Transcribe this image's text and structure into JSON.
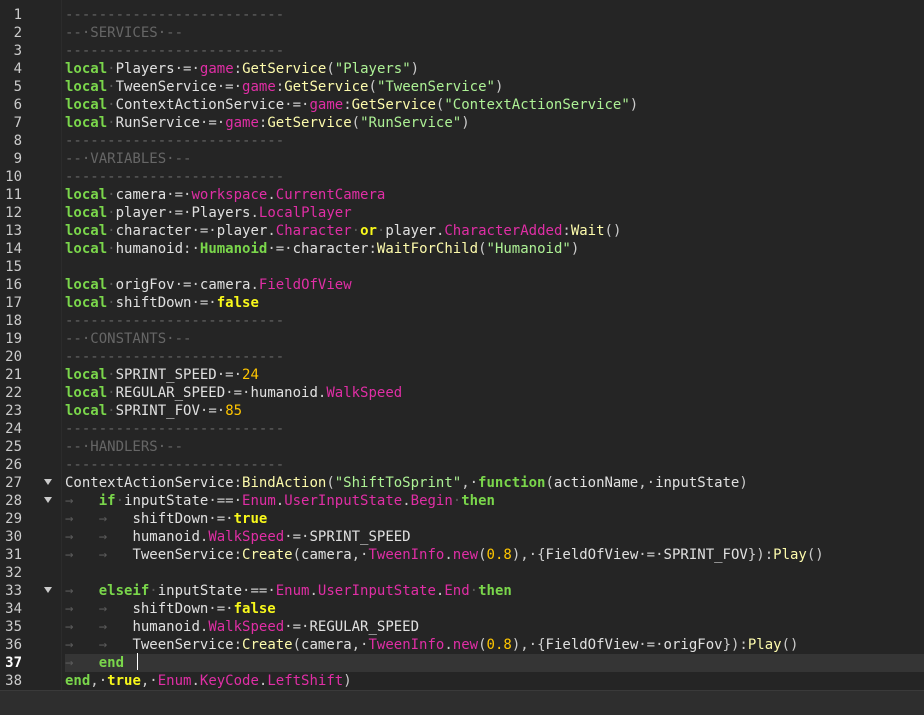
{
  "editor": {
    "current_line": 37,
    "lines": [
      {
        "n": "1",
        "tokens": [
          {
            "t": "--------------------------",
            "c": "cm"
          }
        ]
      },
      {
        "n": "2",
        "tokens": [
          {
            "t": "--·SERVICES·--",
            "c": "cm"
          }
        ]
      },
      {
        "n": "3",
        "tokens": [
          {
            "t": "--------------------------",
            "c": "cm"
          }
        ]
      },
      {
        "n": "4",
        "tokens": [
          {
            "t": "local",
            "c": "kw2"
          },
          {
            "t": "·",
            "c": "ws"
          },
          {
            "t": "Players",
            "c": "id"
          },
          {
            "t": "·=·",
            "c": "op"
          },
          {
            "t": "game",
            "c": "blt"
          },
          {
            "t": ":",
            "c": "op"
          },
          {
            "t": "GetService",
            "c": "met"
          },
          {
            "t": "(",
            "c": "op"
          },
          {
            "t": "\"Players\"",
            "c": "str"
          },
          {
            "t": ")",
            "c": "op"
          }
        ]
      },
      {
        "n": "5",
        "tokens": [
          {
            "t": "local",
            "c": "kw2"
          },
          {
            "t": "·",
            "c": "ws"
          },
          {
            "t": "TweenService",
            "c": "id"
          },
          {
            "t": "·=·",
            "c": "op"
          },
          {
            "t": "game",
            "c": "blt"
          },
          {
            "t": ":",
            "c": "op"
          },
          {
            "t": "GetService",
            "c": "met"
          },
          {
            "t": "(",
            "c": "op"
          },
          {
            "t": "\"TweenService\"",
            "c": "str"
          },
          {
            "t": ")",
            "c": "op"
          }
        ]
      },
      {
        "n": "6",
        "tokens": [
          {
            "t": "local",
            "c": "kw2"
          },
          {
            "t": "·",
            "c": "ws"
          },
          {
            "t": "ContextActionService",
            "c": "id"
          },
          {
            "t": "·=·",
            "c": "op"
          },
          {
            "t": "game",
            "c": "blt"
          },
          {
            "t": ":",
            "c": "op"
          },
          {
            "t": "GetService",
            "c": "met"
          },
          {
            "t": "(",
            "c": "op"
          },
          {
            "t": "\"ContextActionService\"",
            "c": "str"
          },
          {
            "t": ")",
            "c": "op"
          }
        ]
      },
      {
        "n": "7",
        "tokens": [
          {
            "t": "local",
            "c": "kw2"
          },
          {
            "t": "·",
            "c": "ws"
          },
          {
            "t": "RunService",
            "c": "id"
          },
          {
            "t": "·=·",
            "c": "op"
          },
          {
            "t": "game",
            "c": "blt"
          },
          {
            "t": ":",
            "c": "op"
          },
          {
            "t": "GetService",
            "c": "met"
          },
          {
            "t": "(",
            "c": "op"
          },
          {
            "t": "\"RunService\"",
            "c": "str"
          },
          {
            "t": ")",
            "c": "op"
          }
        ]
      },
      {
        "n": "8",
        "tokens": [
          {
            "t": "--------------------------",
            "c": "cm"
          }
        ]
      },
      {
        "n": "9",
        "tokens": [
          {
            "t": "--·VARIABLES·--",
            "c": "cm"
          }
        ]
      },
      {
        "n": "10",
        "tokens": [
          {
            "t": "--------------------------",
            "c": "cm"
          }
        ]
      },
      {
        "n": "11",
        "tokens": [
          {
            "t": "local",
            "c": "kw2"
          },
          {
            "t": "·",
            "c": "ws"
          },
          {
            "t": "camera",
            "c": "id"
          },
          {
            "t": "·=·",
            "c": "op"
          },
          {
            "t": "workspace",
            "c": "blt"
          },
          {
            "t": ".",
            "c": "op"
          },
          {
            "t": "CurrentCamera",
            "c": "blt"
          }
        ]
      },
      {
        "n": "12",
        "tokens": [
          {
            "t": "local",
            "c": "kw2"
          },
          {
            "t": "·",
            "c": "ws"
          },
          {
            "t": "player",
            "c": "id"
          },
          {
            "t": "·=·",
            "c": "op"
          },
          {
            "t": "Players",
            "c": "id"
          },
          {
            "t": ".",
            "c": "op"
          },
          {
            "t": "LocalPlayer",
            "c": "blt"
          }
        ]
      },
      {
        "n": "13",
        "tokens": [
          {
            "t": "local",
            "c": "kw2"
          },
          {
            "t": "·",
            "c": "ws"
          },
          {
            "t": "character",
            "c": "id"
          },
          {
            "t": "·=·",
            "c": "op"
          },
          {
            "t": "player",
            "c": "id"
          },
          {
            "t": ".",
            "c": "op"
          },
          {
            "t": "Character",
            "c": "blt"
          },
          {
            "t": "·",
            "c": "ws"
          },
          {
            "t": "or",
            "c": "kw"
          },
          {
            "t": "·",
            "c": "ws"
          },
          {
            "t": "player",
            "c": "id"
          },
          {
            "t": ".",
            "c": "op"
          },
          {
            "t": "CharacterAdded",
            "c": "blt"
          },
          {
            "t": ":",
            "c": "op"
          },
          {
            "t": "Wait",
            "c": "met"
          },
          {
            "t": "()",
            "c": "op"
          }
        ]
      },
      {
        "n": "14",
        "tokens": [
          {
            "t": "local",
            "c": "kw2"
          },
          {
            "t": "·",
            "c": "ws"
          },
          {
            "t": "humanoid",
            "c": "id"
          },
          {
            "t": ":·",
            "c": "op"
          },
          {
            "t": "Humanoid",
            "c": "kw2"
          },
          {
            "t": "·=·",
            "c": "op"
          },
          {
            "t": "character",
            "c": "id"
          },
          {
            "t": ":",
            "c": "op"
          },
          {
            "t": "WaitForChild",
            "c": "met"
          },
          {
            "t": "(",
            "c": "op"
          },
          {
            "t": "\"Humanoid\"",
            "c": "str"
          },
          {
            "t": ")",
            "c": "op"
          }
        ]
      },
      {
        "n": "15",
        "tokens": []
      },
      {
        "n": "16",
        "tokens": [
          {
            "t": "local",
            "c": "kw2"
          },
          {
            "t": "·",
            "c": "ws"
          },
          {
            "t": "origFov",
            "c": "id"
          },
          {
            "t": "·=·",
            "c": "op"
          },
          {
            "t": "camera",
            "c": "id"
          },
          {
            "t": ".",
            "c": "op"
          },
          {
            "t": "FieldOfView",
            "c": "blt"
          }
        ]
      },
      {
        "n": "17",
        "tokens": [
          {
            "t": "local",
            "c": "kw2"
          },
          {
            "t": "·",
            "c": "ws"
          },
          {
            "t": "shiftDown",
            "c": "id"
          },
          {
            "t": "·=·",
            "c": "op"
          },
          {
            "t": "false",
            "c": "kw"
          }
        ]
      },
      {
        "n": "18",
        "tokens": [
          {
            "t": "--------------------------",
            "c": "cm"
          }
        ]
      },
      {
        "n": "19",
        "tokens": [
          {
            "t": "--·CONSTANTS·--",
            "c": "cm"
          }
        ]
      },
      {
        "n": "20",
        "tokens": [
          {
            "t": "--------------------------",
            "c": "cm"
          }
        ]
      },
      {
        "n": "21",
        "tokens": [
          {
            "t": "local",
            "c": "kw2"
          },
          {
            "t": "·",
            "c": "ws"
          },
          {
            "t": "SPRINT_SPEED",
            "c": "id"
          },
          {
            "t": "·=·",
            "c": "op"
          },
          {
            "t": "24",
            "c": "num"
          }
        ]
      },
      {
        "n": "22",
        "tokens": [
          {
            "t": "local",
            "c": "kw2"
          },
          {
            "t": "·",
            "c": "ws"
          },
          {
            "t": "REGULAR_SPEED",
            "c": "id"
          },
          {
            "t": "·=·",
            "c": "op"
          },
          {
            "t": "humanoid",
            "c": "id"
          },
          {
            "t": ".",
            "c": "op"
          },
          {
            "t": "WalkSpeed",
            "c": "blt"
          }
        ]
      },
      {
        "n": "23",
        "tokens": [
          {
            "t": "local",
            "c": "kw2"
          },
          {
            "t": "·",
            "c": "ws"
          },
          {
            "t": "SPRINT_FOV",
            "c": "id"
          },
          {
            "t": "·=·",
            "c": "op"
          },
          {
            "t": "85",
            "c": "num"
          }
        ]
      },
      {
        "n": "24",
        "tokens": [
          {
            "t": "--------------------------",
            "c": "cm"
          }
        ]
      },
      {
        "n": "25",
        "tokens": [
          {
            "t": "--·HANDLERS·--",
            "c": "cm"
          }
        ]
      },
      {
        "n": "26",
        "tokens": [
          {
            "t": "--------------------------",
            "c": "cm"
          }
        ]
      },
      {
        "n": "27",
        "fold": true,
        "tokens": [
          {
            "t": "ContextActionService",
            "c": "id"
          },
          {
            "t": ":",
            "c": "op"
          },
          {
            "t": "BindAction",
            "c": "met"
          },
          {
            "t": "(",
            "c": "op"
          },
          {
            "t": "\"ShiftToSprint\"",
            "c": "str"
          },
          {
            "t": ",·",
            "c": "op"
          },
          {
            "t": "function",
            "c": "kw2"
          },
          {
            "t": "(",
            "c": "op"
          },
          {
            "t": "actionName",
            "c": "id"
          },
          {
            "t": ",·",
            "c": "op"
          },
          {
            "t": "inputState",
            "c": "id"
          },
          {
            "t": ")",
            "c": "op"
          }
        ]
      },
      {
        "n": "28",
        "fold": true,
        "tokens": [
          {
            "t": "→   ",
            "c": "tabarrow"
          },
          {
            "t": "if",
            "c": "kw2"
          },
          {
            "t": "·",
            "c": "ws"
          },
          {
            "t": "inputState",
            "c": "id"
          },
          {
            "t": "·==·",
            "c": "op"
          },
          {
            "t": "Enum",
            "c": "blt"
          },
          {
            "t": ".",
            "c": "op"
          },
          {
            "t": "UserInputState",
            "c": "blt"
          },
          {
            "t": ".",
            "c": "op"
          },
          {
            "t": "Begin",
            "c": "blt"
          },
          {
            "t": "·",
            "c": "ws"
          },
          {
            "t": "then",
            "c": "kw2"
          }
        ]
      },
      {
        "n": "29",
        "tokens": [
          {
            "t": "→   →   ",
            "c": "tabarrow"
          },
          {
            "t": "shiftDown",
            "c": "id"
          },
          {
            "t": "·=·",
            "c": "op"
          },
          {
            "t": "true",
            "c": "kw"
          }
        ]
      },
      {
        "n": "30",
        "tokens": [
          {
            "t": "→   →   ",
            "c": "tabarrow"
          },
          {
            "t": "humanoid",
            "c": "id"
          },
          {
            "t": ".",
            "c": "op"
          },
          {
            "t": "WalkSpeed",
            "c": "blt"
          },
          {
            "t": "·=·",
            "c": "op"
          },
          {
            "t": "SPRINT_SPEED",
            "c": "id"
          }
        ]
      },
      {
        "n": "31",
        "tokens": [
          {
            "t": "→   →   ",
            "c": "tabarrow"
          },
          {
            "t": "TweenService",
            "c": "id"
          },
          {
            "t": ":",
            "c": "op"
          },
          {
            "t": "Create",
            "c": "met"
          },
          {
            "t": "(",
            "c": "op"
          },
          {
            "t": "camera",
            "c": "id"
          },
          {
            "t": ",·",
            "c": "op"
          },
          {
            "t": "TweenInfo",
            "c": "blt"
          },
          {
            "t": ".",
            "c": "op"
          },
          {
            "t": "new",
            "c": "blt"
          },
          {
            "t": "(",
            "c": "op"
          },
          {
            "t": "0.8",
            "c": "num"
          },
          {
            "t": "),·{",
            "c": "op"
          },
          {
            "t": "FieldOfView",
            "c": "id"
          },
          {
            "t": "·=·",
            "c": "op"
          },
          {
            "t": "SPRINT_FOV",
            "c": "id"
          },
          {
            "t": "}):",
            "c": "op"
          },
          {
            "t": "Play",
            "c": "met"
          },
          {
            "t": "()",
            "c": "op"
          }
        ]
      },
      {
        "n": "32",
        "tokens": []
      },
      {
        "n": "33",
        "fold": true,
        "tokens": [
          {
            "t": "→   ",
            "c": "tabarrow"
          },
          {
            "t": "elseif",
            "c": "kw2"
          },
          {
            "t": "·",
            "c": "ws"
          },
          {
            "t": "inputState",
            "c": "id"
          },
          {
            "t": "·==·",
            "c": "op"
          },
          {
            "t": "Enum",
            "c": "blt"
          },
          {
            "t": ".",
            "c": "op"
          },
          {
            "t": "UserInputState",
            "c": "blt"
          },
          {
            "t": ".",
            "c": "op"
          },
          {
            "t": "End",
            "c": "blt"
          },
          {
            "t": "·",
            "c": "ws"
          },
          {
            "t": "then",
            "c": "kw2"
          }
        ]
      },
      {
        "n": "34",
        "tokens": [
          {
            "t": "→   →   ",
            "c": "tabarrow"
          },
          {
            "t": "shiftDown",
            "c": "id"
          },
          {
            "t": "·=·",
            "c": "op"
          },
          {
            "t": "false",
            "c": "kw"
          }
        ]
      },
      {
        "n": "35",
        "tokens": [
          {
            "t": "→   →   ",
            "c": "tabarrow"
          },
          {
            "t": "humanoid",
            "c": "id"
          },
          {
            "t": ".",
            "c": "op"
          },
          {
            "t": "WalkSpeed",
            "c": "blt"
          },
          {
            "t": "·=·",
            "c": "op"
          },
          {
            "t": "REGULAR_SPEED",
            "c": "id"
          }
        ]
      },
      {
        "n": "36",
        "tokens": [
          {
            "t": "→   →   ",
            "c": "tabarrow"
          },
          {
            "t": "TweenService",
            "c": "id"
          },
          {
            "t": ":",
            "c": "op"
          },
          {
            "t": "Create",
            "c": "met"
          },
          {
            "t": "(",
            "c": "op"
          },
          {
            "t": "camera",
            "c": "id"
          },
          {
            "t": ",·",
            "c": "op"
          },
          {
            "t": "TweenInfo",
            "c": "blt"
          },
          {
            "t": ".",
            "c": "op"
          },
          {
            "t": "new",
            "c": "blt"
          },
          {
            "t": "(",
            "c": "op"
          },
          {
            "t": "0.8",
            "c": "num"
          },
          {
            "t": "),·{",
            "c": "op"
          },
          {
            "t": "FieldOfView",
            "c": "id"
          },
          {
            "t": "·=·",
            "c": "op"
          },
          {
            "t": "origFov",
            "c": "id"
          },
          {
            "t": "}):",
            "c": "op"
          },
          {
            "t": "Play",
            "c": "met"
          },
          {
            "t": "()",
            "c": "op"
          }
        ]
      },
      {
        "n": "37",
        "tokens": [
          {
            "t": "→   ",
            "c": "tabarrow"
          },
          {
            "t": "end",
            "c": "kw2"
          }
        ]
      },
      {
        "n": "38",
        "tokens": [
          {
            "t": "end",
            "c": "kw2"
          },
          {
            "t": ",·",
            "c": "op"
          },
          {
            "t": "true",
            "c": "kw"
          },
          {
            "t": ",·",
            "c": "op"
          },
          {
            "t": "Enum",
            "c": "blt"
          },
          {
            "t": ".",
            "c": "op"
          },
          {
            "t": "KeyCode",
            "c": "blt"
          },
          {
            "t": ".",
            "c": "op"
          },
          {
            "t": "LeftShift",
            "c": "blt"
          },
          {
            "t": ")",
            "c": "op"
          }
        ]
      }
    ]
  },
  "colors": {
    "background": "#252525",
    "keyword_green": "#7ad64b",
    "keyword_yellow": "#f8f81b",
    "builtin_magenta": "#e02ea5",
    "string_green": "#adf195",
    "number_orange": "#ffc600",
    "comment_gray": "#666666",
    "current_line": "#353535"
  },
  "icons": {
    "fold": "fold-arrow-icon",
    "tab": "tab-arrow-icon"
  }
}
